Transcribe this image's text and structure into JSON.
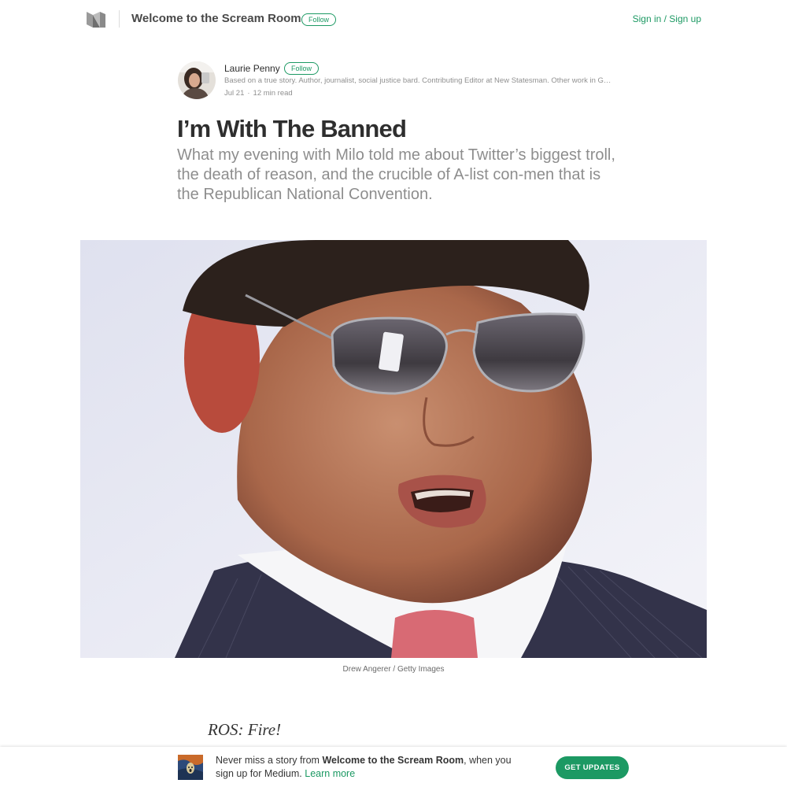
{
  "nav": {
    "publication_name": "Welcome to the Scream Room",
    "follow_label": "Follow",
    "signin_label": "Sign in / Sign up"
  },
  "author": {
    "name": "Laurie Penny",
    "follow_label": "Follow",
    "bio": "Based on a true story. Author, journalist, social justice bard. Contributing Editor at New Statesman. Other work in Guardian, Buzzfeed, Vice.",
    "date": "Jul 21",
    "separator": "·",
    "read_time": "12 min read"
  },
  "article": {
    "title": "I’m With The Banned",
    "subtitle": "What my evening with Milo told me about Twitter’s biggest troll, the death of reason, and the crucible of A-list con-men that is the Republican National Convention.",
    "image_caption": "Drew Angerer / Getty Images",
    "first_line": "ROS: Fire!"
  },
  "footer": {
    "prefix": "Never miss a story from ",
    "publication": "Welcome to the Scream Room",
    "suffix": ", when you sign up for Medium. ",
    "learn_more": "Learn more",
    "button_label": "GET UPDATES"
  },
  "colors": {
    "accent": "#1c9963"
  },
  "icons": {
    "logo": "medium-logo-icon"
  }
}
